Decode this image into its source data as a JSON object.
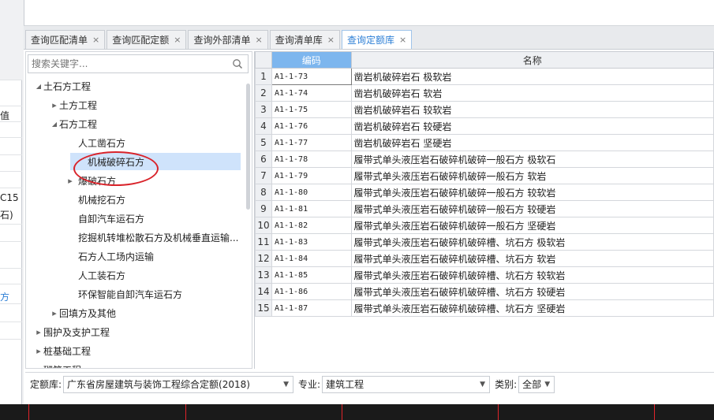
{
  "left_fragments": [
    "值",
    "C15",
    "石)",
    "方"
  ],
  "tabs": [
    {
      "label": "查询匹配清单",
      "active": false
    },
    {
      "label": "查询匹配定额",
      "active": false
    },
    {
      "label": "查询外部清单",
      "active": false
    },
    {
      "label": "查询清单库",
      "active": false
    },
    {
      "label": "查询定额库",
      "active": true
    }
  ],
  "tab_close_glyph": "×",
  "search": {
    "placeholder": "搜索关键字..."
  },
  "tree": [
    {
      "label": "土石方工程",
      "level": 0,
      "arrow": "down"
    },
    {
      "label": "土方工程",
      "level": 1,
      "arrow": "right"
    },
    {
      "label": "石方工程",
      "level": 1,
      "arrow": "down"
    },
    {
      "label": "人工凿石方",
      "level": 2,
      "arrow": ""
    },
    {
      "label": "机械破碎石方",
      "level": 2,
      "arrow": "",
      "selected": true
    },
    {
      "label": "爆破石方",
      "level": 2,
      "arrow": "right"
    },
    {
      "label": "机械挖石方",
      "level": 2,
      "arrow": ""
    },
    {
      "label": "自卸汽车运石方",
      "level": 2,
      "arrow": ""
    },
    {
      "label": "挖掘机转堆松散石方及机械垂直运输...",
      "level": 2,
      "arrow": ""
    },
    {
      "label": "石方人工场内运输",
      "level": 2,
      "arrow": ""
    },
    {
      "label": "人工装石方",
      "level": 2,
      "arrow": ""
    },
    {
      "label": "环保智能自卸汽车运石方",
      "level": 2,
      "arrow": ""
    },
    {
      "label": "回填方及其他",
      "level": 1,
      "arrow": "right"
    },
    {
      "label": "围护及支护工程",
      "level": 0,
      "arrow": "right"
    },
    {
      "label": "桩基础工程",
      "level": 0,
      "arrow": "right"
    },
    {
      "label": "砌筑工程",
      "level": 0,
      "arrow": "right"
    }
  ],
  "table": {
    "columns": [
      "编码",
      "名称"
    ],
    "rows": [
      {
        "n": "1",
        "code": "A1-1-73",
        "name": "凿岩机破碎岩石 极软岩"
      },
      {
        "n": "2",
        "code": "A1-1-74",
        "name": "凿岩机破碎岩石 软岩"
      },
      {
        "n": "3",
        "code": "A1-1-75",
        "name": "凿岩机破碎岩石 较软岩"
      },
      {
        "n": "4",
        "code": "A1-1-76",
        "name": "凿岩机破碎岩石 较硬岩"
      },
      {
        "n": "5",
        "code": "A1-1-77",
        "name": "凿岩机破碎岩石 坚硬岩"
      },
      {
        "n": "6",
        "code": "A1-1-78",
        "name": "履带式单头液压岩石破碎机破碎一般石方 极软石"
      },
      {
        "n": "7",
        "code": "A1-1-79",
        "name": "履带式单头液压岩石破碎机破碎一般石方 软岩"
      },
      {
        "n": "8",
        "code": "A1-1-80",
        "name": "履带式单头液压岩石破碎机破碎一般石方 较软岩"
      },
      {
        "n": "9",
        "code": "A1-1-81",
        "name": "履带式单头液压岩石破碎机破碎一般石方 较硬岩"
      },
      {
        "n": "10",
        "code": "A1-1-82",
        "name": "履带式单头液压岩石破碎机破碎一般石方 坚硬岩"
      },
      {
        "n": "11",
        "code": "A1-1-83",
        "name": "履带式单头液压岩石破碎机破碎槽、坑石方 极软岩"
      },
      {
        "n": "12",
        "code": "A1-1-84",
        "name": "履带式单头液压岩石破碎机破碎槽、坑石方 软岩"
      },
      {
        "n": "13",
        "code": "A1-1-85",
        "name": "履带式单头液压岩石破碎机破碎槽、坑石方 较软岩"
      },
      {
        "n": "14",
        "code": "A1-1-86",
        "name": "履带式单头液压岩石破碎机破碎槽、坑石方 较硬岩"
      },
      {
        "n": "15",
        "code": "A1-1-87",
        "name": "履带式单头液压岩石破碎机破碎槽、坑石方 坚硬岩"
      }
    ]
  },
  "bottom": {
    "library_label": "定额库:",
    "library_value": "广东省房屋建筑与装饰工程综合定额(2018)",
    "major_label": "专业:",
    "major_value": "建筑工程",
    "category_label": "类别:",
    "category_value": "全部"
  },
  "colors": {
    "accent": "#2d7fd6",
    "header_active": "#7db6ee",
    "annotation": "#d9232a",
    "selected_row": "#cfe3fb"
  }
}
